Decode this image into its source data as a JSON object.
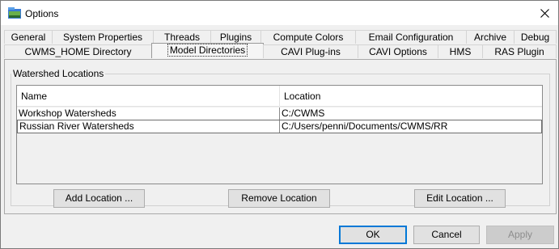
{
  "window": {
    "title": "Options",
    "icon": "options-app-icon",
    "close_icon": "close-icon"
  },
  "tabs_row1": [
    {
      "label": "General",
      "selected": false
    },
    {
      "label": "System Properties",
      "selected": false
    },
    {
      "label": "Threads",
      "selected": false
    },
    {
      "label": "Plugins",
      "selected": false
    },
    {
      "label": "Compute Colors",
      "selected": false
    },
    {
      "label": "Email Configuration",
      "selected": false
    },
    {
      "label": "Archive",
      "selected": false
    },
    {
      "label": "Debug",
      "selected": false
    }
  ],
  "tabs_row2": [
    {
      "label": "CWMS_HOME Directory",
      "selected": false
    },
    {
      "label": "Model Directories",
      "selected": true
    },
    {
      "label": "CAVI Plug-ins",
      "selected": false
    },
    {
      "label": "CAVI Options",
      "selected": false
    },
    {
      "label": "HMS",
      "selected": false
    },
    {
      "label": "RAS Plugin",
      "selected": false
    }
  ],
  "group": {
    "title": "Watershed Locations"
  },
  "table": {
    "columns": [
      "Name",
      "Location"
    ],
    "rows": [
      {
        "name": "Workshop Watersheds",
        "location": "C:/CWMS"
      },
      {
        "name": "Russian River Watersheds",
        "location": "C:/Users/penni/Documents/CWMS/RR"
      }
    ]
  },
  "actions": {
    "add": "Add Location ...",
    "remove": "Remove Location",
    "edit": "Edit Location ..."
  },
  "dialog_buttons": {
    "ok": "OK",
    "cancel": "Cancel",
    "apply": "Apply"
  },
  "colors": {
    "default_button_border": "#0078d7",
    "window_bg": "#f0f0f0"
  }
}
